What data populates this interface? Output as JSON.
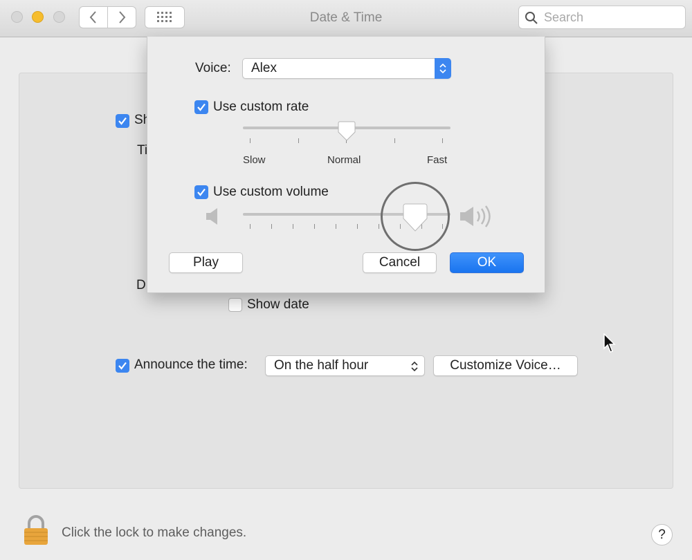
{
  "window": {
    "title": "Date & Time",
    "search_placeholder": "Search"
  },
  "main": {
    "show_clock_label_partial": "Sh",
    "time_label_partial": "Ti",
    "date_label_partial": "D",
    "show_date_label": "Show date",
    "show_date_checked": false,
    "announce_label": "Announce the time:",
    "announce_checked": true,
    "announce_interval": "On the half hour",
    "customize_voice_label": "Customize Voice…"
  },
  "sheet": {
    "voice_label": "Voice:",
    "voice_value": "Alex",
    "custom_rate_label": "Use custom rate",
    "custom_rate_checked": true,
    "rate_labels": {
      "slow": "Slow",
      "normal": "Normal",
      "fast": "Fast"
    },
    "rate_value": 0.5,
    "custom_volume_label": "Use custom volume",
    "custom_volume_checked": true,
    "volume_value": 0.83,
    "play_label": "Play",
    "cancel_label": "Cancel",
    "ok_label": "OK"
  },
  "footer": {
    "lock_text": "Click the lock to make changes.",
    "help_label": "?"
  },
  "colors": {
    "accent": "#3c86f0",
    "lock_gold": "#e8a53c"
  }
}
